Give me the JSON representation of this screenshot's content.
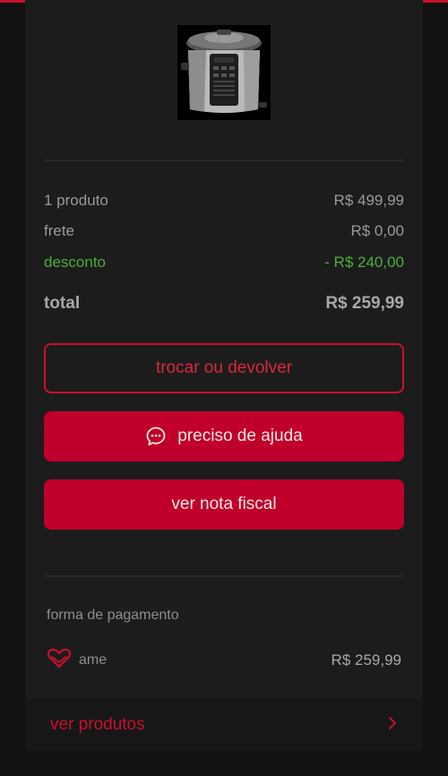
{
  "product": {
    "image_alt": "panela elétrica"
  },
  "summary": {
    "items_label": "1 produto",
    "items_value": "R$ 499,99",
    "shipping_label": "frete",
    "shipping_value": "R$ 0,00",
    "discount_label": "desconto",
    "discount_value": "- R$ 240,00",
    "total_label": "total",
    "total_value": "R$ 259,99"
  },
  "actions": {
    "return_label": "trocar ou devolver",
    "help_label": "preciso de ajuda",
    "invoice_label": "ver nota fiscal"
  },
  "payment": {
    "title": "forma de pagamento",
    "method": "ame",
    "value": "R$ 259,99"
  },
  "footer": {
    "link_label": "ver produtos"
  },
  "colors": {
    "accent": "#c8102e",
    "discount": "#4caf3a",
    "background": "#121212",
    "card": "#1c1c1c"
  },
  "icons": [
    "chat-bubble-icon",
    "heart-icon",
    "chevron-right-icon"
  ]
}
